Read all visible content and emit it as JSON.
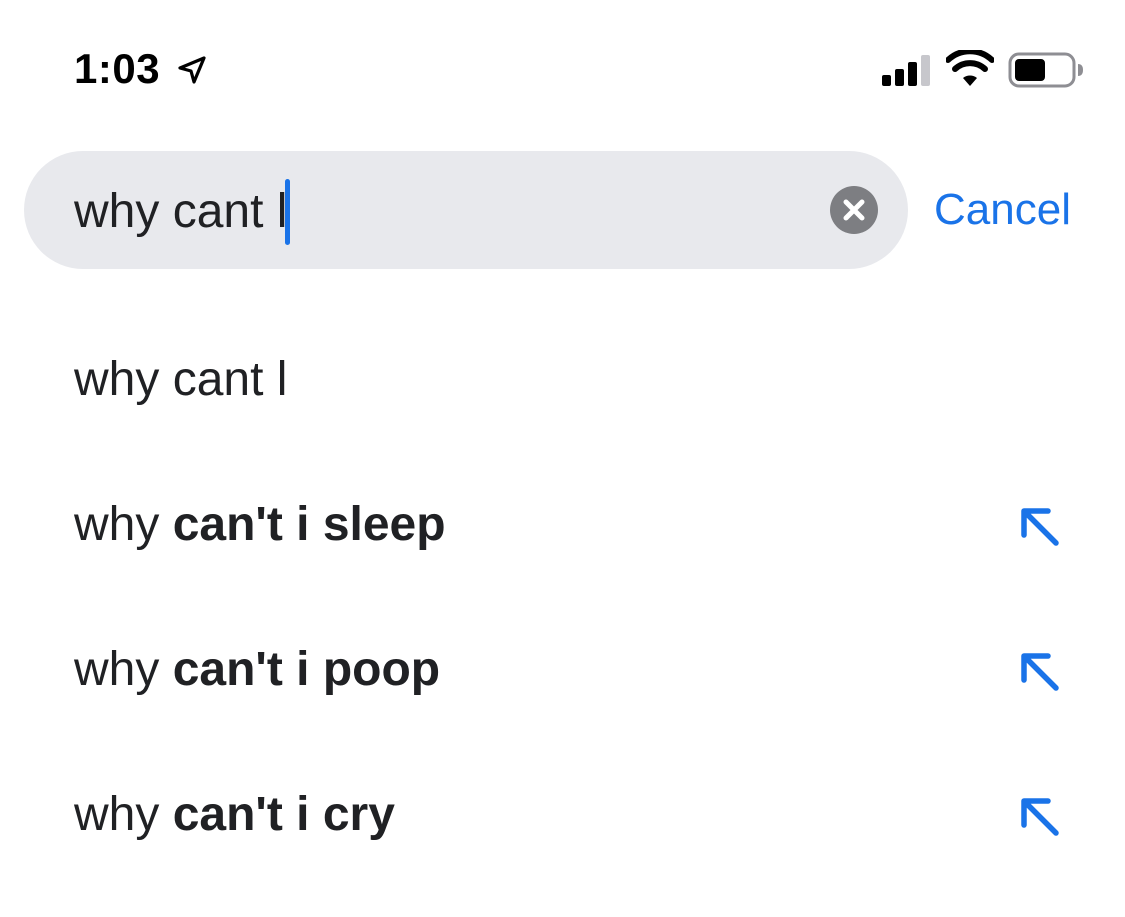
{
  "status_bar": {
    "time": "1:03",
    "icons": [
      "location-arrow-icon",
      "cellular-signal-icon",
      "wifi-icon",
      "battery-icon"
    ]
  },
  "search": {
    "query": "why cant l",
    "cancel_label": "Cancel",
    "clear_icon": "clear-circle-icon"
  },
  "suggestions": [
    {
      "plain": "why cant l",
      "bold": "",
      "rest": "",
      "fill_icon": ""
    },
    {
      "plain": "why ",
      "bold": "can't i sleep",
      "rest": "",
      "fill_icon": "arrow-up-left-icon"
    },
    {
      "plain": "why ",
      "bold": "can't i poop",
      "rest": "",
      "fill_icon": "arrow-up-left-icon"
    },
    {
      "plain": "why ",
      "bold": "can't i cry",
      "rest": "",
      "fill_icon": "arrow-up-left-icon"
    }
  ],
  "colors": {
    "accent": "#1a73e8",
    "search_bg": "#e8e9ed",
    "text": "#202124",
    "clear_bg": "#7d7e82"
  }
}
